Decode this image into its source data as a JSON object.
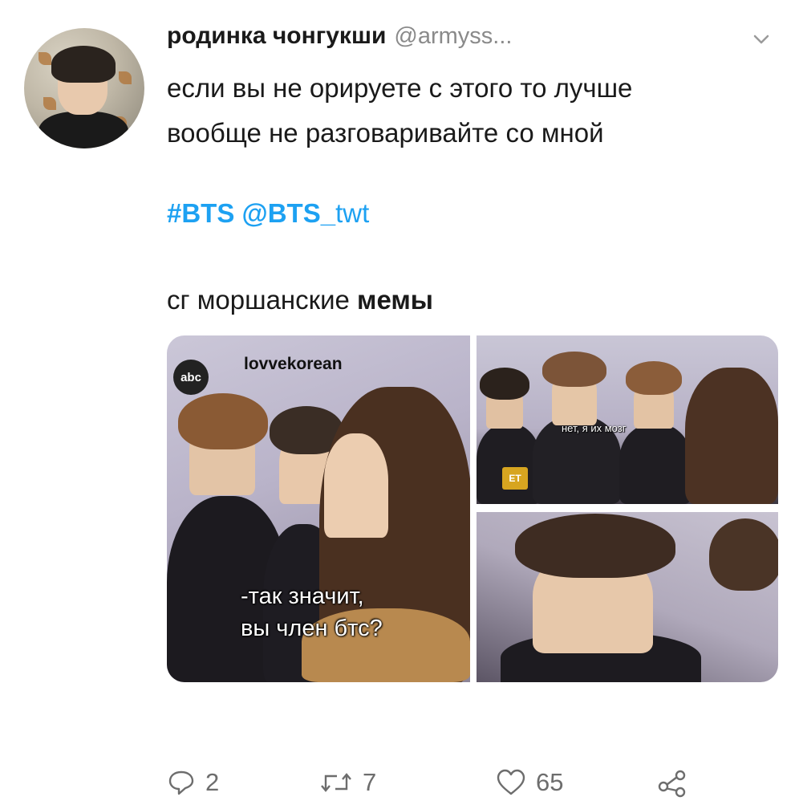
{
  "tweet": {
    "display_name": "родинка чонгукши",
    "handle": "@armyss...",
    "text_lines": [
      "если вы не орируете с этого то лучше",
      "вообще не разговаривайте со мной"
    ],
    "hashtag": "#BTS",
    "mention": "@BTS_",
    "mention_tail": "twt",
    "caption_prefix": "сг моршанские ",
    "caption_bold": "мемы",
    "menu_icon": "chevron-down-icon"
  },
  "media": {
    "watermark": "lovvekorean",
    "logo_text": "abc",
    "subtitle_line1": "-так значит,",
    "subtitle_line2": "вы член бтс?",
    "subtitle_small": "нет, я их мозг",
    "badge": "ET"
  },
  "actions": {
    "reply_count": "2",
    "retweet_count": "7",
    "like_count": "65",
    "reply_icon": "reply-icon",
    "retweet_icon": "retweet-icon",
    "like_icon": "heart-icon",
    "share_icon": "share-icon"
  },
  "colors": {
    "link": "#1da1f2",
    "text": "#1a1a1a",
    "muted": "#6d6d6d"
  }
}
